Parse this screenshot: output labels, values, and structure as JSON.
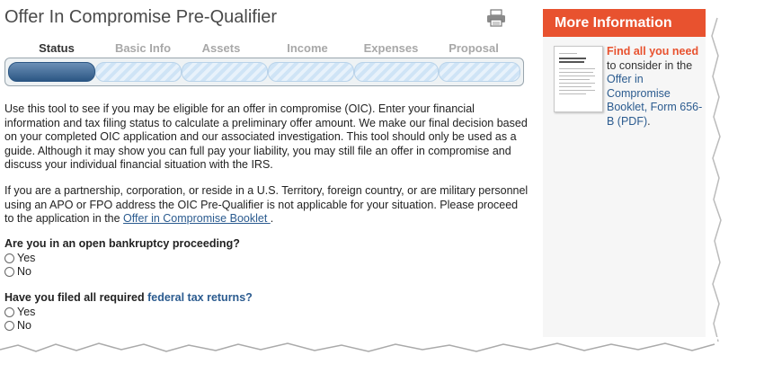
{
  "header": {
    "title": "Offer In Compromise Pre-Qualifier",
    "print_icon": "print-icon"
  },
  "steps": [
    "Status",
    "Basic Info",
    "Assets",
    "Income",
    "Expenses",
    "Proposal"
  ],
  "progress": {
    "current_step": 1,
    "total_steps": 6
  },
  "intro": {
    "p1": "Use this tool to see if you may be eligible for an offer in compromise (OIC). Enter your financial information and tax filing status to calculate a preliminary offer amount. We make our final decision based on your completed OIC application and our associated investigation. This tool should only be used as a guide. Although it may show you can full pay your liability, you may still file an offer in compromise and discuss your individual financial situation with the IRS.",
    "p2_before": "If you are a partnership, corporation, or reside in a U.S. Territory, foreign country, or are military personnel using an APO or FPO address the OIC Pre-Qualifier is not applicable for your situation. Please proceed to the application in the ",
    "p2_link": "Offer in Compromise Booklet ",
    "p2_after": "."
  },
  "questions": {
    "q1": {
      "label": "Are you in an open bankruptcy proceeding?",
      "yes": "Yes",
      "no": "No"
    },
    "q2": {
      "label_before": "Have you filed all required ",
      "label_link": "federal tax returns?",
      "yes": "Yes",
      "no": "No"
    }
  },
  "sidebar": {
    "title": "More Information",
    "highlight": "Find all you need",
    "text": " to consider in the ",
    "link": "Offer in Compromise Booklet, Form 656-B (PDF)",
    "after": "."
  },
  "colors": {
    "accent": "#e8522f",
    "link": "#2b5b8f",
    "progress_active": "#2c5784"
  }
}
